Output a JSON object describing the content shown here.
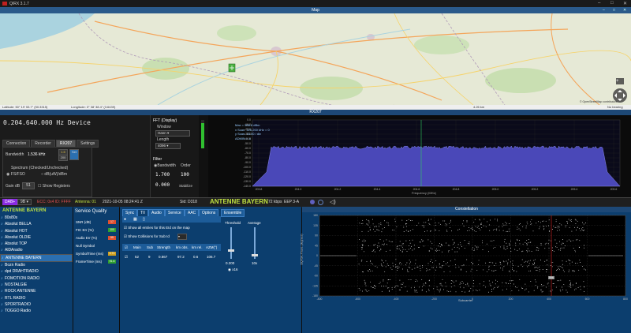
{
  "window": {
    "title": "QIRX 3.1.7"
  },
  "map": {
    "header": "Map",
    "status_left": "Latitude: 50° 19' 53.7\" (50.3315)",
    "status_mid": "Longitude: 3° 38' 38.4\" (3.6439)",
    "status_right": "No bearing",
    "attribution": "© OpenStreetMap contributors",
    "zoom_label": "4.26 km"
  },
  "rx": {
    "header": "RX207",
    "frequency": "0.204.640.000 Hz Device",
    "tabs": [
      "Connection",
      "Recorder",
      "RX207",
      "Settings"
    ],
    "active_tab": "RX207",
    "bandwidth_label": "Bandwidth",
    "bandwidth_value": "1.536 kHz",
    "bw_opt1": "1.5",
    "bw_opt2": "200",
    "spectrum_label": "Spectrum (Checked/Unchecked)",
    "opt_ff": "FS/FSO",
    "opt_dbm": "dB(uW)/dBm",
    "gain_label": "Gain dB",
    "gain_value": "51",
    "show_registers": "Show Registers"
  },
  "fft": {
    "title": "FFT (Display)",
    "window_label": "Window",
    "window_value": "Hann",
    "length_label": "Length",
    "length_value": "4096",
    "filter_label": "Filter",
    "filter_option": "Bandwidth",
    "order_label": "Order",
    "val1": "1.700",
    "val2": "100",
    "val3": "0.000",
    "val4": "Stabilize"
  },
  "spectrum": {
    "legend": [
      "Max = 388.8 dBm",
      "x Scan: 226,200 kHz = 0",
      "y Scan: 15.00 / div",
      "ADMIN = 4"
    ],
    "y_ticks": [
      "0.0",
      "-10.0",
      "-20.0",
      "-30.0",
      "-40.0",
      "-50.0",
      "-60.0",
      "-70.0",
      "-80.0",
      "-90.0",
      "-100.0",
      "-110.0",
      "-120.0",
      "-130.0",
      "-140.0"
    ],
    "x_ticks": [
      "203.8",
      "204.0",
      "204.2",
      "204.4",
      "204.6",
      "204.8",
      "205.0",
      "205.2",
      "205.4",
      "205.6"
    ],
    "xlabel": "Frequency (MHz)"
  },
  "dab": {
    "channel_label": "DAB+",
    "channel_value": "9B",
    "ecc": "ECC: 0x4 ID: FFFF",
    "antenna": "Antenna: 01",
    "datetime": "2021-10-05 08:24:41 Z",
    "sid": "Sid: D318",
    "station_name": "ANTENNE BAYERN",
    "bitrate": "72 kbps",
    "eep": "EEP 3-A"
  },
  "stations": {
    "header": "ANTENNE BAYERN",
    "items": [
      "80s80s",
      "Absolut BELLA",
      "Absolut HOT",
      "Absolut OLDIE",
      "Absolut TOP",
      "AlDAradio",
      "ANTENNE BAYERN",
      "Bozn Radio",
      "dpd DRAHTRADIO",
      "FOMOTION RADIO",
      "NOSTALGIE",
      "ROCK ANTENNE",
      "RTL RADIO",
      "SPORTRADIO",
      "TOGGO Radio"
    ],
    "selected": "ANTENNE BAYERN"
  },
  "quality": {
    "title": "Service Quality",
    "rows": [
      {
        "label": "SNR (dB)",
        "value": "17",
        "color": "#e05030"
      },
      {
        "label": "FIC Err (%)",
        "value": "100",
        "color": "#30a030"
      },
      {
        "label": "Audio Err (%)",
        "value": "95",
        "color": "#e05030"
      },
      {
        "label": "Null Symbol",
        "value": "",
        "color": "#0c3e6e"
      },
      {
        "label": "SymbolTime (ms)",
        "value": "0.71",
        "color": "#d0a020"
      },
      {
        "label": "FrameTime (ms)",
        "value": "91.6",
        "color": "#30a030"
      }
    ]
  },
  "tii": {
    "tabs": [
      "Sync",
      "TII",
      "Audio",
      "Service",
      "AAC",
      "Options",
      "Ensemble"
    ],
    "active_tab": "TII",
    "opt1": "Show all entries for this EId on the map",
    "opt2": "Show Collisions for Sub Id",
    "headers": [
      "Main",
      "Sub",
      "Strength",
      "km obs.",
      "km rel.",
      "AZM(°)"
    ],
    "row": [
      "52",
      "9",
      "0.867",
      "97.2",
      "0.6",
      "106.7"
    ],
    "threshold_label": "Threshold",
    "threshold_value": "0.200",
    "average_label": "Average",
    "average_value": "10x",
    "x16": "x16"
  },
  "constellation": {
    "header": "Constellation",
    "y_ticks": [
      "180",
      "135",
      "90",
      "45",
      "0",
      "-45",
      "-90",
      "-135",
      "-180"
    ],
    "x_ticks": [
      "-800",
      "-600",
      "-400",
      "-200",
      "0",
      "200",
      "400",
      "600",
      "800"
    ],
    "ylabel": "DQPSK Phase (degrees)",
    "xlabel": "Subcarrier",
    "marker": "556"
  },
  "colors": {
    "accent": "#2b6fb0",
    "panel": "#0c3e6e",
    "spectrum_fill": "#4a48b8",
    "station_green": "#c0e040"
  }
}
